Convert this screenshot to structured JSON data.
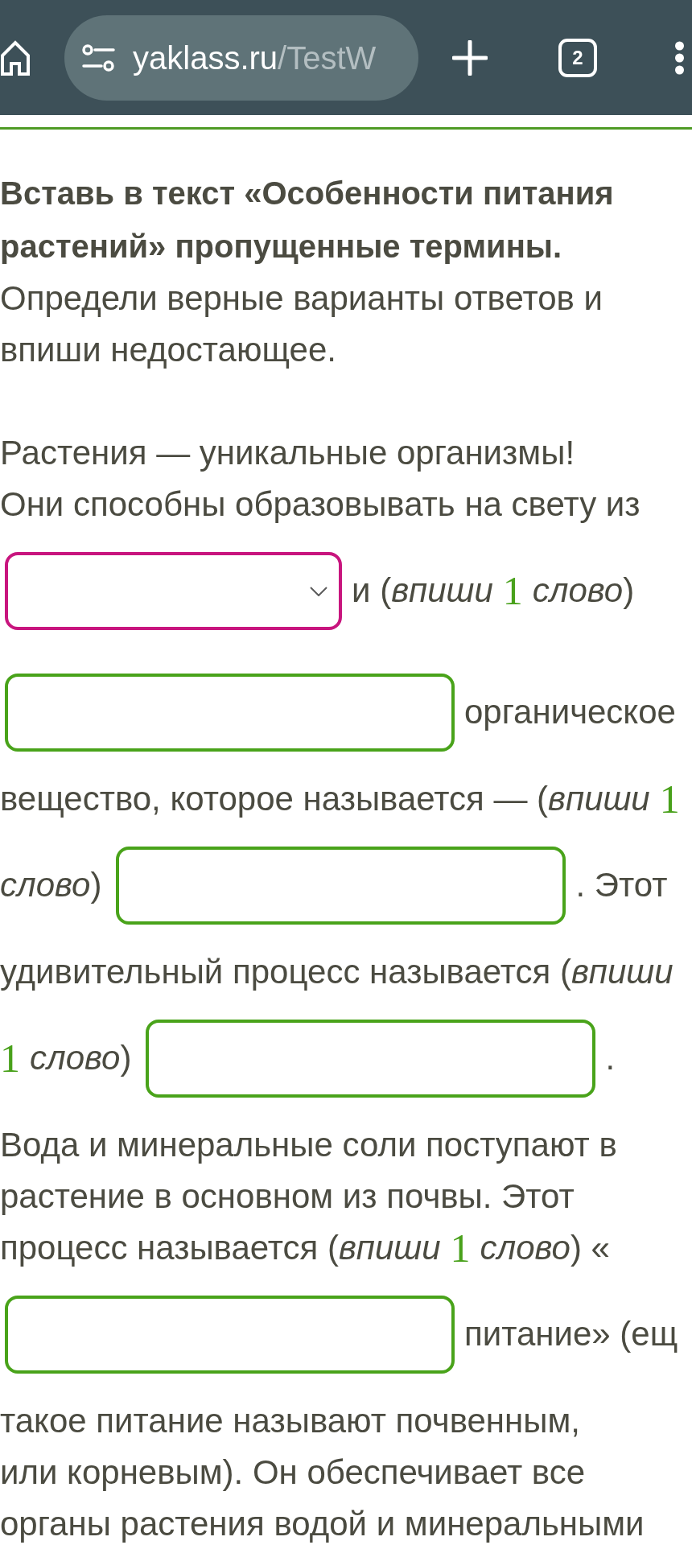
{
  "browser": {
    "url": {
      "host": "yaklass.ru",
      "path": "/TestW"
    },
    "tab_count": "2"
  },
  "task": {
    "heading": "Вставь в текст «Особенности питания растений» пропущенные термины.",
    "instruction": "Определи верные варианты ответов и впиши недостающее.",
    "lines": [
      [
        {
          "kind": "text",
          "text": "Растения — уникальные организмы!"
        }
      ],
      [
        {
          "kind": "text",
          "text": "Они способны образовывать на свету из"
        }
      ],
      [
        {
          "kind": "select"
        },
        {
          "kind": "text",
          "text": "и (*впиши*"
        },
        {
          "kind": "count",
          "text": "1"
        },
        {
          "kind": "text",
          "text": "*слово*)"
        }
      ],
      [
        {
          "kind": "input"
        },
        {
          "kind": "text",
          "text": "органическое"
        }
      ],
      [
        {
          "kind": "text",
          "text": "вещество, которое называется — (*впиши*"
        },
        {
          "kind": "count",
          "text": "1"
        }
      ],
      [
        {
          "kind": "text",
          "text": "*слово*)"
        },
        {
          "kind": "input"
        },
        {
          "kind": "text",
          "text": ". Этот"
        }
      ],
      [
        {
          "kind": "text",
          "text": "удивительный процесс называется (*впиши*"
        }
      ],
      [
        {
          "kind": "count",
          "text": "1"
        },
        {
          "kind": "text",
          "text": "*слово*)"
        },
        {
          "kind": "input"
        },
        {
          "kind": "text",
          "text": "."
        }
      ],
      [
        {
          "kind": "text",
          "text": "Вода и минеральные соли поступают в"
        }
      ],
      [
        {
          "kind": "text",
          "text": "растение в основном из почвы. Этот"
        }
      ],
      [
        {
          "kind": "text",
          "text": "процесс называется (*впиши*"
        },
        {
          "kind": "count",
          "text": "1"
        },
        {
          "kind": "text",
          "text": "*слово*) «"
        }
      ],
      [
        {
          "kind": "input"
        },
        {
          "kind": "text",
          "text": "питание» (ещ"
        }
      ],
      [
        {
          "kind": "text",
          "text": "такое питание называют почвенным,"
        }
      ],
      [
        {
          "kind": "text",
          "text": "или корневым). Он обеспечивает все"
        }
      ],
      [
        {
          "kind": "text",
          "text": "органы растения водой и минеральными"
        }
      ]
    ]
  }
}
